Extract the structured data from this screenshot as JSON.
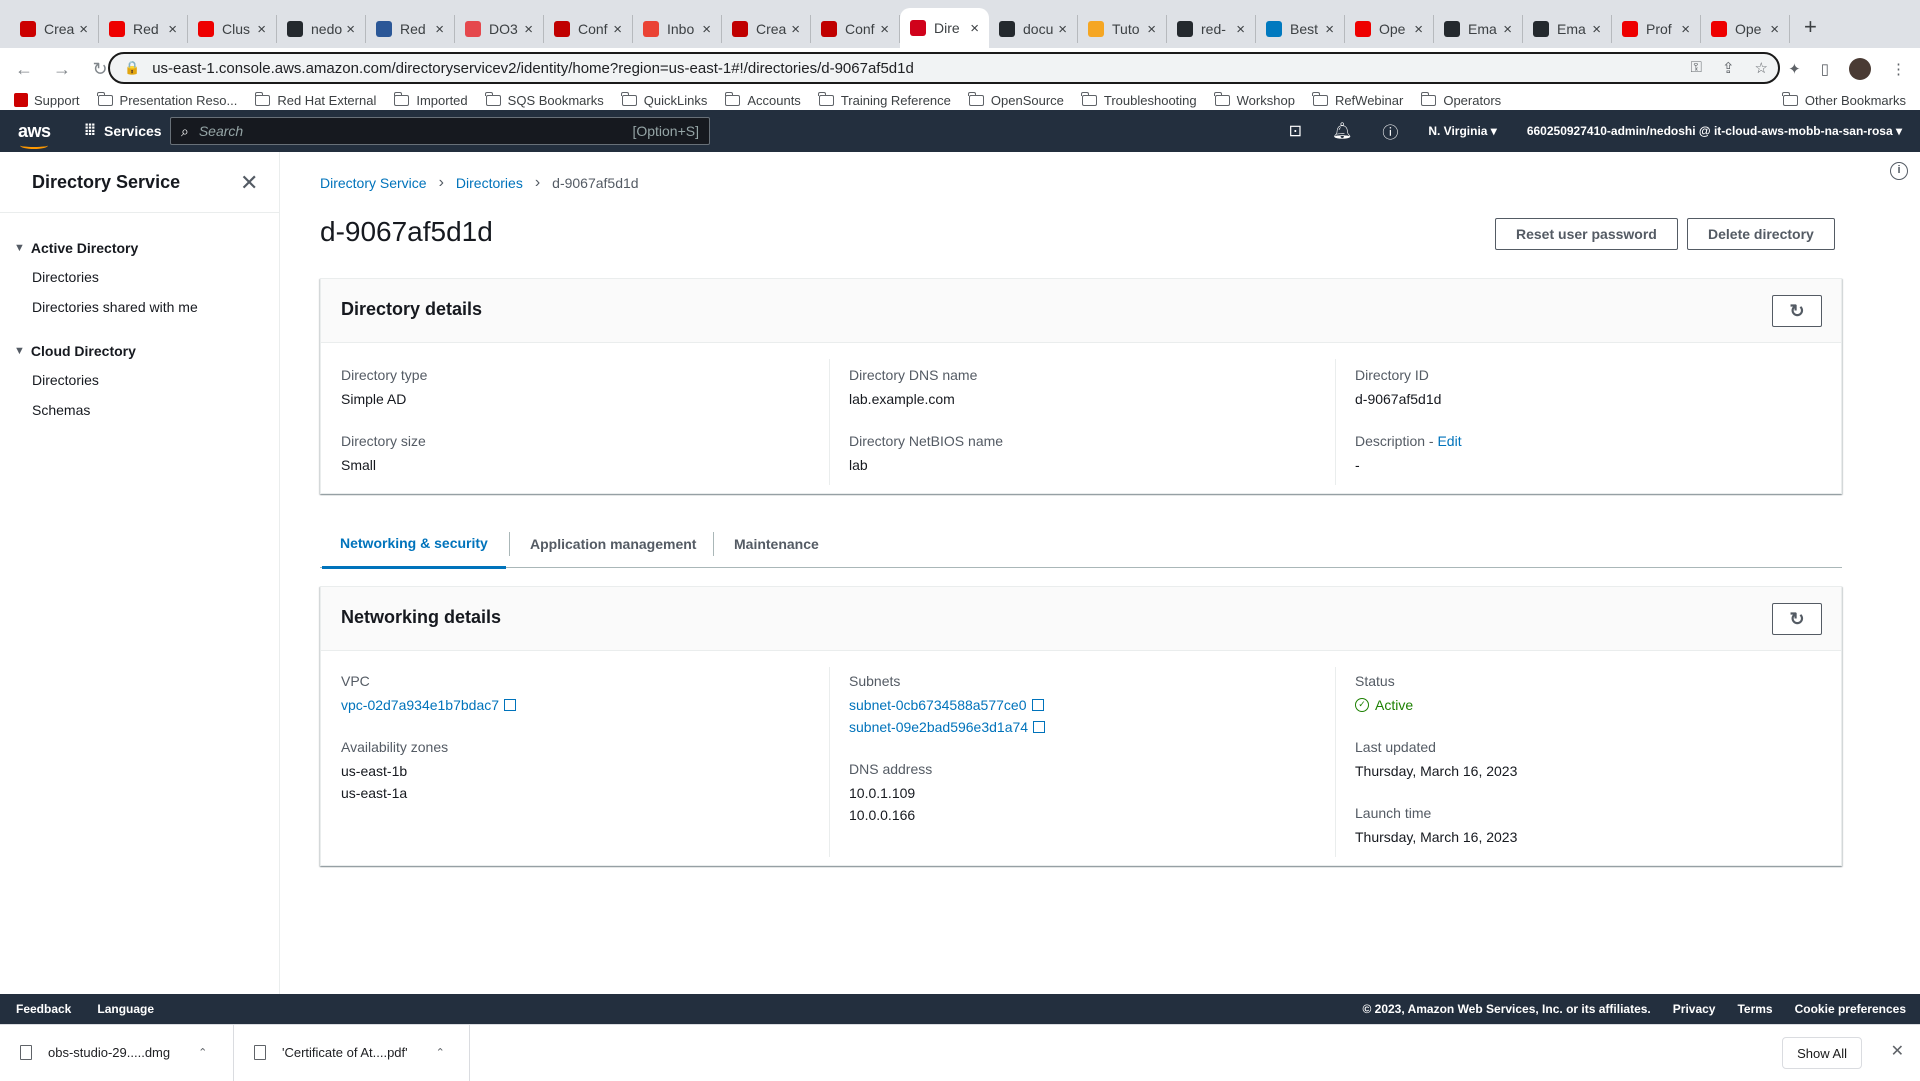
{
  "browser": {
    "tabs": [
      {
        "title": "Crea",
        "color": "#cc0000"
      },
      {
        "title": "Red",
        "color": "#ee0000"
      },
      {
        "title": "Clus",
        "color": "#ee0000"
      },
      {
        "title": "nedo",
        "color": "#24292e"
      },
      {
        "title": "Red",
        "color": "#2b5797"
      },
      {
        "title": "DO3",
        "color": "#e5484d"
      },
      {
        "title": "Conf",
        "color": "#c00000"
      },
      {
        "title": "Inbo",
        "color": "#ea4335"
      },
      {
        "title": "Crea",
        "color": "#c00000"
      },
      {
        "title": "Conf",
        "color": "#c00000"
      },
      {
        "title": "Dire",
        "color": "#d0021b",
        "active": true
      },
      {
        "title": "docu",
        "color": "#24292e"
      },
      {
        "title": "Tuto",
        "color": "#f5a623"
      },
      {
        "title": "red-",
        "color": "#24292e"
      },
      {
        "title": "Best",
        "color": "#0079bf"
      },
      {
        "title": "Ope",
        "color": "#ee0000"
      },
      {
        "title": "Ema",
        "color": "#24292e"
      },
      {
        "title": "Ema",
        "color": "#24292e"
      },
      {
        "title": "Prof",
        "color": "#ee0000"
      },
      {
        "title": "Ope",
        "color": "#ee0000"
      }
    ],
    "url": "us-east-1.console.aws.amazon.com/directoryservicev2/identity/home?region=us-east-1#!/directories/d-9067af5d1d",
    "bookmarks": [
      "Support",
      "Presentation Reso...",
      "Red Hat External",
      "Imported",
      "SQS Bookmarks",
      "QuickLinks",
      "Accounts",
      "Training Reference",
      "OpenSource",
      "Troubleshooting",
      "Workshop",
      "RefWebinar",
      "Operators"
    ],
    "other_bookmarks": "Other Bookmarks"
  },
  "aws_nav": {
    "logo": "aws",
    "services": "Services",
    "search_placeholder": "Search",
    "search_shortcut": "[Option+S]",
    "region": "N. Virginia",
    "account": "660250927410-admin/nedoshi @ it-cloud-aws-mobb-na-san-rosa"
  },
  "sidebar": {
    "title": "Directory Service",
    "sections": [
      {
        "label": "Active Directory",
        "items": [
          "Directories",
          "Directories shared with me"
        ]
      },
      {
        "label": "Cloud Directory",
        "items": [
          "Directories",
          "Schemas"
        ]
      }
    ]
  },
  "breadcrumb": [
    "Directory Service",
    "Directories",
    "d-9067af5d1d"
  ],
  "page_title": "d-9067af5d1d",
  "actions": {
    "reset_password": "Reset user password",
    "delete_directory": "Delete directory"
  },
  "directory_details": {
    "heading": "Directory details",
    "directory_type_label": "Directory type",
    "directory_type": "Simple AD",
    "directory_size_label": "Directory size",
    "directory_size": "Small",
    "dns_name_label": "Directory DNS name",
    "dns_name": "lab.example.com",
    "netbios_label": "Directory NetBIOS name",
    "netbios": "lab",
    "directory_id_label": "Directory ID",
    "directory_id": "d-9067af5d1d",
    "description_label": "Description - ",
    "description_edit": "Edit",
    "description": "-"
  },
  "tabs": [
    "Networking & security",
    "Application management",
    "Maintenance"
  ],
  "networking": {
    "heading": "Networking details",
    "vpc_label": "VPC",
    "vpc": "vpc-02d7a934e1b7bdac7",
    "az_label": "Availability zones",
    "azs": [
      "us-east-1b",
      "us-east-1a"
    ],
    "subnets_label": "Subnets",
    "subnets": [
      "subnet-0cb6734588a577ce0",
      "subnet-09e2bad596e3d1a74"
    ],
    "dns_label": "DNS address",
    "dns": [
      "10.0.1.109",
      "10.0.0.166"
    ],
    "status_label": "Status",
    "status": "Active",
    "status_color": "#1d8102",
    "updated_label": "Last updated",
    "updated": "Thursday, March 16, 2023",
    "launch_label": "Launch time",
    "launch": "Thursday, March 16, 2023"
  },
  "footer": {
    "feedback": "Feedback",
    "language": "Language",
    "copyright": "© 2023, Amazon Web Services, Inc. or its affiliates.",
    "privacy": "Privacy",
    "terms": "Terms",
    "cookies": "Cookie preferences"
  },
  "downloads": [
    {
      "name": "obs-studio-29.....dmg"
    },
    {
      "name": "'Certificate of At....pdf'"
    }
  ],
  "show_all": "Show All"
}
